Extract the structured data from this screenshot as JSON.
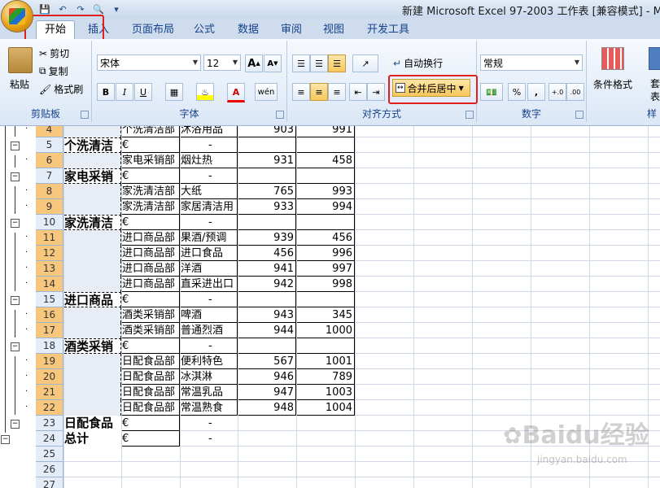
{
  "window": {
    "title": "新建 Microsoft Excel 97-2003 工作表  [兼容模式] - Micr"
  },
  "ribbon_tabs": [
    {
      "label": "开始",
      "active": true
    },
    {
      "label": "插入"
    },
    {
      "label": "页面布局"
    },
    {
      "label": "公式"
    },
    {
      "label": "数据"
    },
    {
      "label": "审阅"
    },
    {
      "label": "视图"
    },
    {
      "label": "开发工具"
    }
  ],
  "clipboard": {
    "paste": "粘贴",
    "cut": "剪切",
    "copy": "复制",
    "format_painter": "格式刷",
    "label": "剪贴板"
  },
  "font": {
    "name": "宋体",
    "size": "12",
    "label": "字体",
    "bold": "B",
    "italic": "I",
    "underline": "U",
    "grow": "A",
    "shrink": "A",
    "font_color": "A",
    "phonetic": "wén"
  },
  "alignment": {
    "wrap_text": "自动换行",
    "merge_center": "合并后居中",
    "label": "对齐方式"
  },
  "number": {
    "format": "常规",
    "percent": "%",
    "comma": ",",
    "inc_decimal": "+.0",
    "dec_decimal": ".00",
    "label": "数字"
  },
  "styles": {
    "conditional": "条件格式",
    "table_format": "套\n表格格",
    "cell_styles": "样"
  },
  "rows": [
    {
      "num": "4",
      "a": "",
      "b": "个洗清洁部",
      "c": "沐浴用品",
      "d": "903",
      "e": "991",
      "sel": true
    },
    {
      "num": "5",
      "a": "个洗清洁",
      "b": "€",
      "c": "",
      "d": "",
      "e": "",
      "dash": "-",
      "sel": false,
      "summary": true
    },
    {
      "num": "6",
      "a": "",
      "b": "家电采销部",
      "c": "烟灶热",
      "d": "931",
      "e": "458",
      "sel": true
    },
    {
      "num": "7",
      "a": "家电采销",
      "b": "€",
      "c": "",
      "d": "",
      "e": "",
      "dash": "-",
      "sel": false,
      "summary": true
    },
    {
      "num": "8",
      "a": "",
      "b": "家洗清洁部",
      "c": "大纸",
      "d": "765",
      "e": "993",
      "sel": true
    },
    {
      "num": "9",
      "a": "",
      "b": "家洗清洁部",
      "c": "家居清洁用",
      "d": "933",
      "e": "994",
      "sel": true
    },
    {
      "num": "10",
      "a": "家洗清洁",
      "b": "€",
      "c": "",
      "d": "",
      "e": "",
      "dash": "-",
      "sel": false,
      "summary": true
    },
    {
      "num": "11",
      "a": "",
      "b": "进口商品部",
      "c": "果酒/预调",
      "d": "939",
      "e": "456",
      "sel": true
    },
    {
      "num": "12",
      "a": "",
      "b": "进口商品部",
      "c": "进口食品",
      "d": "456",
      "e": "996",
      "sel": true
    },
    {
      "num": "13",
      "a": "",
      "b": "进口商品部",
      "c": "洋酒",
      "d": "941",
      "e": "997",
      "sel": true
    },
    {
      "num": "14",
      "a": "",
      "b": "进口商品部",
      "c": "直采进出口",
      "d": "942",
      "e": "998",
      "sel": true
    },
    {
      "num": "15",
      "a": "进口商品",
      "b": "€",
      "c": "",
      "d": "",
      "e": "",
      "dash": "-",
      "sel": false,
      "summary": true
    },
    {
      "num": "16",
      "a": "",
      "b": "酒类采销部",
      "c": "啤酒",
      "d": "943",
      "e": "345",
      "sel": true
    },
    {
      "num": "17",
      "a": "",
      "b": "酒类采销部",
      "c": "普通烈酒",
      "d": "944",
      "e": "1000",
      "sel": true
    },
    {
      "num": "18",
      "a": "酒类采销",
      "b": "€",
      "c": "",
      "d": "",
      "e": "",
      "dash": "-",
      "sel": false,
      "summary": true
    },
    {
      "num": "19",
      "a": "",
      "b": "日配食品部",
      "c": "便利特色",
      "d": "567",
      "e": "1001",
      "sel": true
    },
    {
      "num": "20",
      "a": "",
      "b": "日配食品部",
      "c": "冰淇淋",
      "d": "946",
      "e": "789",
      "sel": true
    },
    {
      "num": "21",
      "a": "",
      "b": "日配食品部",
      "c": "常温乳品",
      "d": "947",
      "e": "1003",
      "sel": true
    },
    {
      "num": "22",
      "a": "",
      "b": "日配食品部",
      "c": "常温熟食",
      "d": "948",
      "e": "1004",
      "sel": true
    },
    {
      "num": "23",
      "a": "日配食品",
      "b": "€",
      "c": "",
      "d": "",
      "e": "",
      "dash": "-",
      "sel": false,
      "summary": true
    },
    {
      "num": "24",
      "a": "总计",
      "b": "€",
      "c": "",
      "d": "",
      "e": "",
      "dash": "-",
      "sel": false,
      "summary": true
    },
    {
      "num": "25",
      "a": "",
      "b": "",
      "c": "",
      "d": "",
      "e": "",
      "sel": false
    },
    {
      "num": "26",
      "a": "",
      "b": "",
      "c": "",
      "d": "",
      "e": "",
      "sel": false
    },
    {
      "num": "27",
      "a": "",
      "b": "",
      "c": "",
      "d": "",
      "e": "",
      "sel": false
    }
  ],
  "watermark": {
    "logo": "Baidu经验",
    "url": "jingyan.baidu.com"
  }
}
